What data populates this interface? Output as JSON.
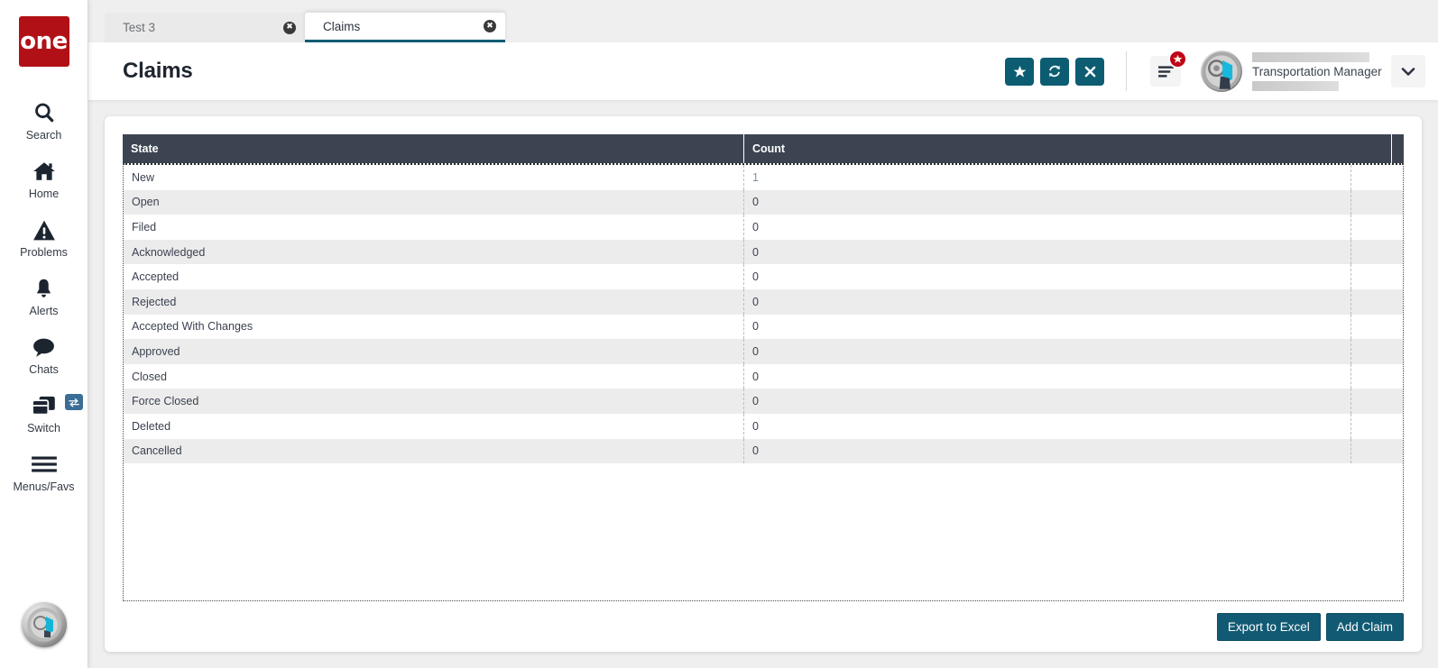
{
  "sidebar": {
    "logo_text": "one",
    "items": [
      {
        "label": "Search",
        "icon": "search-icon"
      },
      {
        "label": "Home",
        "icon": "home-icon"
      },
      {
        "label": "Problems",
        "icon": "warning-triangle-icon"
      },
      {
        "label": "Alerts",
        "icon": "bell-icon"
      },
      {
        "label": "Chats",
        "icon": "chat-bubble-icon"
      },
      {
        "label": "Switch",
        "icon": "windows-stack-icon",
        "badge_icon": "swap-arrows-icon"
      },
      {
        "label": "Menus/Favs",
        "icon": "hamburger-icon"
      }
    ],
    "bottom_avatar_icon": "user-avatar-icon"
  },
  "tabs": [
    {
      "label": "Test 3",
      "active": false,
      "close_icon": "close-circle-icon"
    },
    {
      "label": "Claims",
      "active": true,
      "close_icon": "close-circle-icon"
    }
  ],
  "header": {
    "title": "Claims",
    "actions": [
      {
        "name": "favorite-button",
        "icon": "star-icon"
      },
      {
        "name": "refresh-button",
        "icon": "refresh-icon"
      },
      {
        "name": "close-button",
        "icon": "x-icon"
      }
    ],
    "menu_icon": "menu-lines-icon",
    "menu_badge_icon": "star-icon",
    "user_role": "Transportation Manager",
    "caret_icon": "chevron-down-icon"
  },
  "table": {
    "columns": [
      "State",
      "Count",
      ""
    ],
    "rows": [
      {
        "state": "New",
        "count": "1",
        "is_link": true
      },
      {
        "state": "Open",
        "count": "0",
        "is_link": false
      },
      {
        "state": "Filed",
        "count": "0",
        "is_link": false
      },
      {
        "state": "Acknowledged",
        "count": "0",
        "is_link": false
      },
      {
        "state": "Accepted",
        "count": "0",
        "is_link": false
      },
      {
        "state": "Rejected",
        "count": "0",
        "is_link": false
      },
      {
        "state": "Accepted With Changes",
        "count": "0",
        "is_link": false
      },
      {
        "state": "Approved",
        "count": "0",
        "is_link": false
      },
      {
        "state": "Closed",
        "count": "0",
        "is_link": false
      },
      {
        "state": "Force Closed",
        "count": "0",
        "is_link": false
      },
      {
        "state": "Deleted",
        "count": "0",
        "is_link": false
      },
      {
        "state": "Cancelled",
        "count": "0",
        "is_link": false
      }
    ]
  },
  "footer": {
    "export_label": "Export to Excel",
    "add_label": "Add Claim"
  },
  "colors": {
    "brand_red": "#b11116",
    "accent_teal": "#0c5c72",
    "header_dark": "#3c4452",
    "badge_red": "#c00418",
    "switch_badge_blue": "#3b6e96",
    "link_blue": "#7c93a3"
  }
}
